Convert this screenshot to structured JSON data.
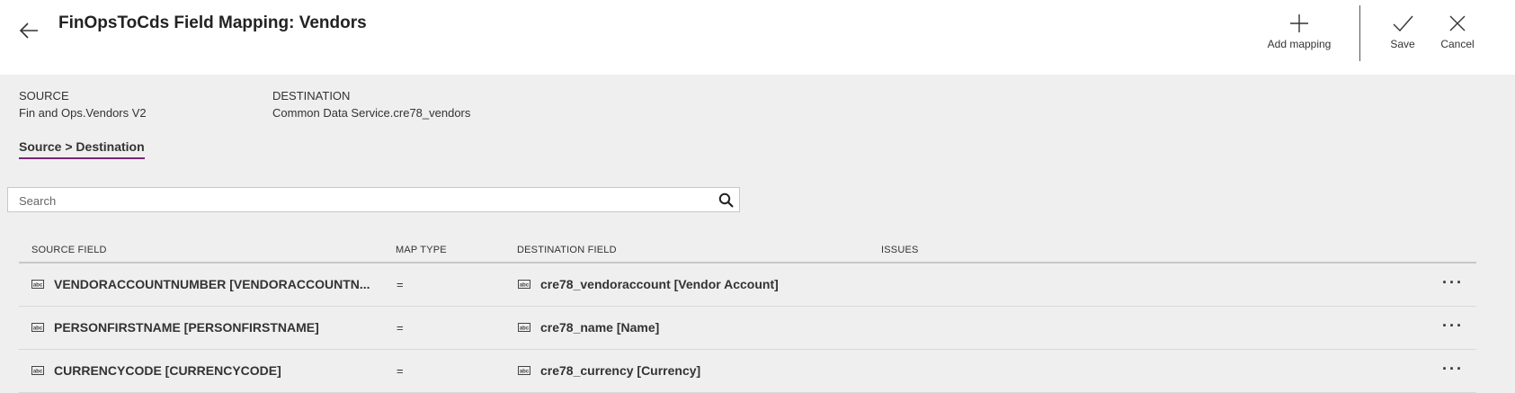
{
  "header": {
    "title": "FinOpsToCds Field Mapping: Vendors",
    "commands": {
      "add_mapping": "Add mapping",
      "save": "Save",
      "cancel": "Cancel"
    }
  },
  "source": {
    "label": "SOURCE",
    "value": "Fin and Ops.Vendors V2"
  },
  "destination": {
    "label": "DESTINATION",
    "value": "Common Data Service.cre78_vendors"
  },
  "tabs": [
    {
      "label": "Source > Destination",
      "active": true
    }
  ],
  "search": {
    "placeholder": "Search",
    "value": ""
  },
  "grid": {
    "columns": {
      "source_field": "SOURCE FIELD",
      "map_type": "MAP TYPE",
      "destination_field": "DESTINATION FIELD",
      "issues": "ISSUES"
    },
    "rows": [
      {
        "source": "VENDORACCOUNTNUMBER [VENDORACCOUNTN...",
        "map_type": "=",
        "destination": "cre78_vendoraccount [Vendor Account]",
        "issues": "",
        "more": "···"
      },
      {
        "source": "PERSONFIRSTNAME [PERSONFIRSTNAME]",
        "map_type": "=",
        "destination": "cre78_name [Name]",
        "issues": "",
        "more": "···"
      },
      {
        "source": "CURRENCYCODE [CURRENCYCODE]",
        "map_type": "=",
        "destination": "cre78_currency [Currency]",
        "issues": "",
        "more": "···"
      }
    ]
  },
  "colors": {
    "tab_underline": "#742774",
    "header_bg": "#ffffff",
    "page_bg": "#efefef"
  },
  "icons": {
    "back": "back-arrow-icon",
    "add": "plus-icon",
    "save": "checkmark-icon",
    "cancel": "close-icon",
    "search": "search-icon",
    "field_type": "text-field-icon"
  }
}
